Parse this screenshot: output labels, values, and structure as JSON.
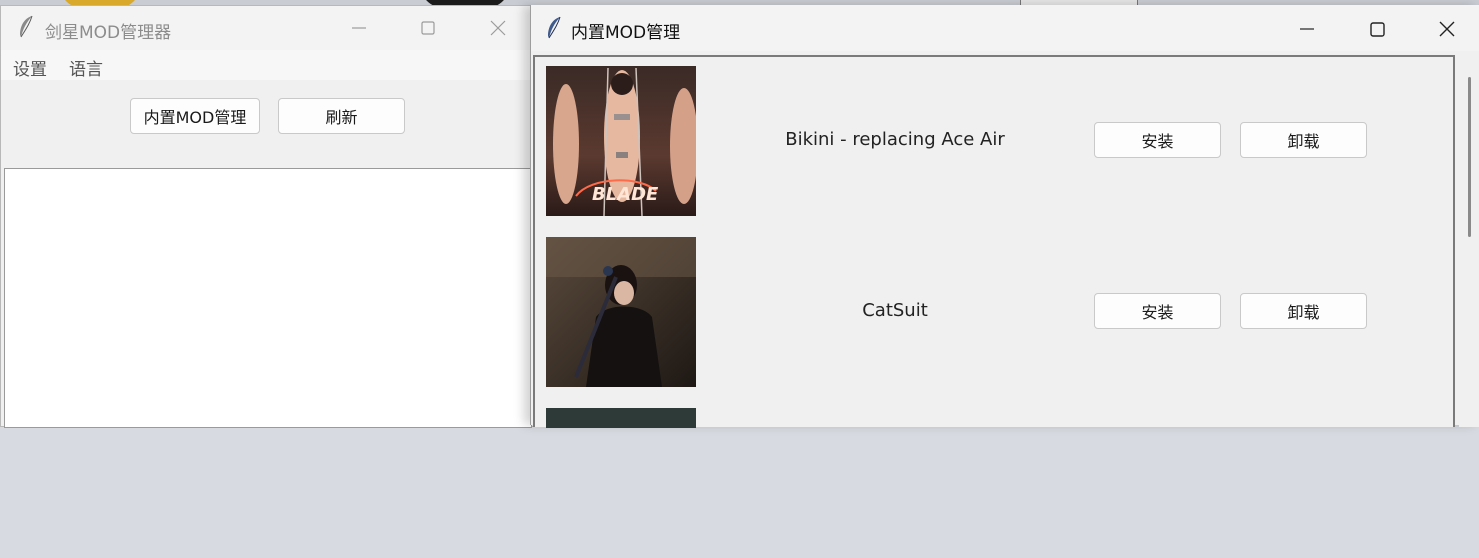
{
  "back_window": {
    "title": "剑星MOD管理器",
    "menu": [
      "设置",
      "语言"
    ],
    "toolbar": {
      "builtin_mod_button": "内置MOD管理",
      "refresh_button": "刷新"
    }
  },
  "front_window": {
    "title": "内置MOD管理",
    "mods": [
      {
        "name": "Bikini - replacing Ace Air",
        "install_label": "安装",
        "uninstall_label": "卸载",
        "thumb_text": "BLADE"
      },
      {
        "name": "CatSuit",
        "install_label": "安装",
        "uninstall_label": "卸载"
      }
    ]
  },
  "icons": {
    "app_icon": "feather-icon",
    "minimize": "minimize-icon",
    "maximize": "maximize-icon",
    "close": "close-icon"
  }
}
